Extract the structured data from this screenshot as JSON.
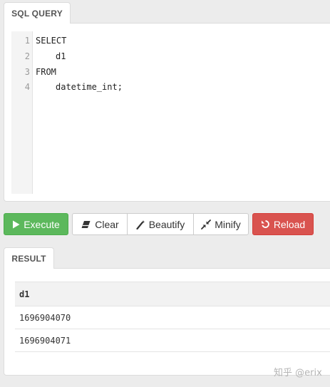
{
  "sql_query": {
    "tab_label": "SQL QUERY",
    "lines": [
      {
        "num": "1",
        "text": "SELECT"
      },
      {
        "num": "2",
        "text": "d1"
      },
      {
        "num": "3",
        "text": "FROM"
      },
      {
        "num": "4",
        "text": "datetime_int;"
      }
    ]
  },
  "toolbar": {
    "execute_label": "Execute",
    "clear_label": "Clear",
    "beautify_label": "Beautify",
    "minify_label": "Minify",
    "reload_label": "Reload"
  },
  "result": {
    "tab_label": "RESULT",
    "columns": [
      "d1"
    ],
    "rows": [
      [
        "1696904070"
      ],
      [
        "1696904071"
      ]
    ]
  },
  "watermark": "知乎 @erix",
  "colors": {
    "execute": "#5cb85c",
    "reload": "#d9534f",
    "keyword": "#770088"
  },
  "icons": {
    "execute": "play-icon",
    "clear": "eraser-icon",
    "beautify": "magic-wand-icon",
    "minify": "compress-icon",
    "reload": "refresh-icon"
  }
}
